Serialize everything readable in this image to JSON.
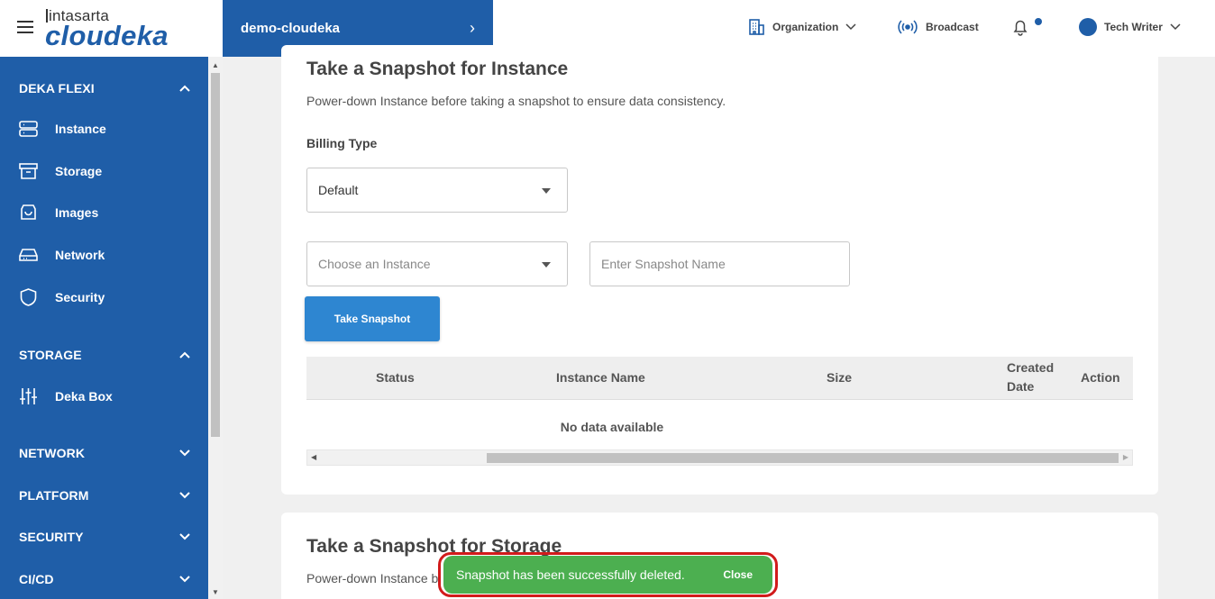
{
  "header": {
    "logo_top": "intasarta",
    "logo_main": "cloudeka",
    "project": "demo-cloudeka",
    "organization": "Organization",
    "broadcast": "Broadcast",
    "user": "Tech Writer"
  },
  "sidebar": {
    "sections": [
      {
        "label": "DEKA FLEXI",
        "expanded": true
      },
      {
        "label": "STORAGE",
        "expanded": true
      },
      {
        "label": "NETWORK",
        "expanded": false
      },
      {
        "label": "PLATFORM",
        "expanded": false
      },
      {
        "label": "SECURITY",
        "expanded": false
      },
      {
        "label": "CI/CD",
        "expanded": false
      }
    ],
    "items": [
      {
        "label": "Instance",
        "icon": "server-icon"
      },
      {
        "label": "Storage",
        "icon": "archive-icon"
      },
      {
        "label": "Images",
        "icon": "image-icon"
      },
      {
        "label": "Network",
        "icon": "hard-drive-icon"
      },
      {
        "label": "Security",
        "icon": "shield-icon"
      },
      {
        "label": "Deka Box",
        "icon": "sliders-icon"
      }
    ]
  },
  "instance_snapshot": {
    "title": "Take a Snapshot for Instance",
    "description": "Power-down Instance before taking a snapshot to ensure data consistency.",
    "billing_label": "Billing Type",
    "billing_value": "Default",
    "instance_placeholder": "Choose an Instance",
    "name_placeholder": "Enter Snapshot Name",
    "button": "Take Snapshot",
    "columns": [
      "Status",
      "Instance Name",
      "Size",
      "Created",
      "Date",
      "Action"
    ],
    "empty": "No data available"
  },
  "storage_snapshot": {
    "title": "Take a Snapshot for Storage",
    "description_partial": "Power-down Instance b"
  },
  "toast": {
    "message": "Snapshot has been successfully deleted.",
    "close": "Close"
  },
  "colors": {
    "brand": "#1f5ea8",
    "button": "#2e86d1",
    "toast": "#4caf50",
    "highlight": "#d11b1b"
  }
}
